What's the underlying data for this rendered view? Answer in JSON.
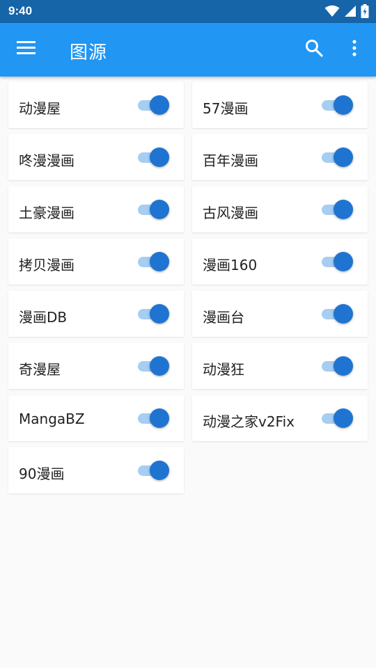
{
  "status_bar": {
    "time": "9:40"
  },
  "app_bar": {
    "title": "图源"
  },
  "sources": [
    {
      "label": "动漫屋",
      "enabled": true
    },
    {
      "label": "57漫画",
      "enabled": true
    },
    {
      "label": "咚漫漫画",
      "enabled": true
    },
    {
      "label": "百年漫画",
      "enabled": true
    },
    {
      "label": "土豪漫画",
      "enabled": true
    },
    {
      "label": "古风漫画",
      "enabled": true
    },
    {
      "label": "拷贝漫画",
      "enabled": true
    },
    {
      "label": "漫画160",
      "enabled": true
    },
    {
      "label": "漫画DB",
      "enabled": true
    },
    {
      "label": "漫画台",
      "enabled": true
    },
    {
      "label": "奇漫屋",
      "enabled": true
    },
    {
      "label": "动漫狂",
      "enabled": true
    },
    {
      "label": "MangaBZ",
      "enabled": true
    },
    {
      "label": "动漫之家v2Fix",
      "enabled": true
    },
    {
      "label": "90漫画",
      "enabled": true
    }
  ],
  "icons": {
    "menu": "menu-icon",
    "search": "search-icon",
    "more": "more-vert-icon",
    "wifi": "wifi-icon",
    "signal": "signal-icon",
    "battery": "battery-charging-icon"
  },
  "colors": {
    "status_bar": "#1565a8",
    "app_bar": "#2196f3",
    "switch_thumb": "#1f74d2",
    "switch_track": "#a6cdf2",
    "background": "#fafafa"
  }
}
